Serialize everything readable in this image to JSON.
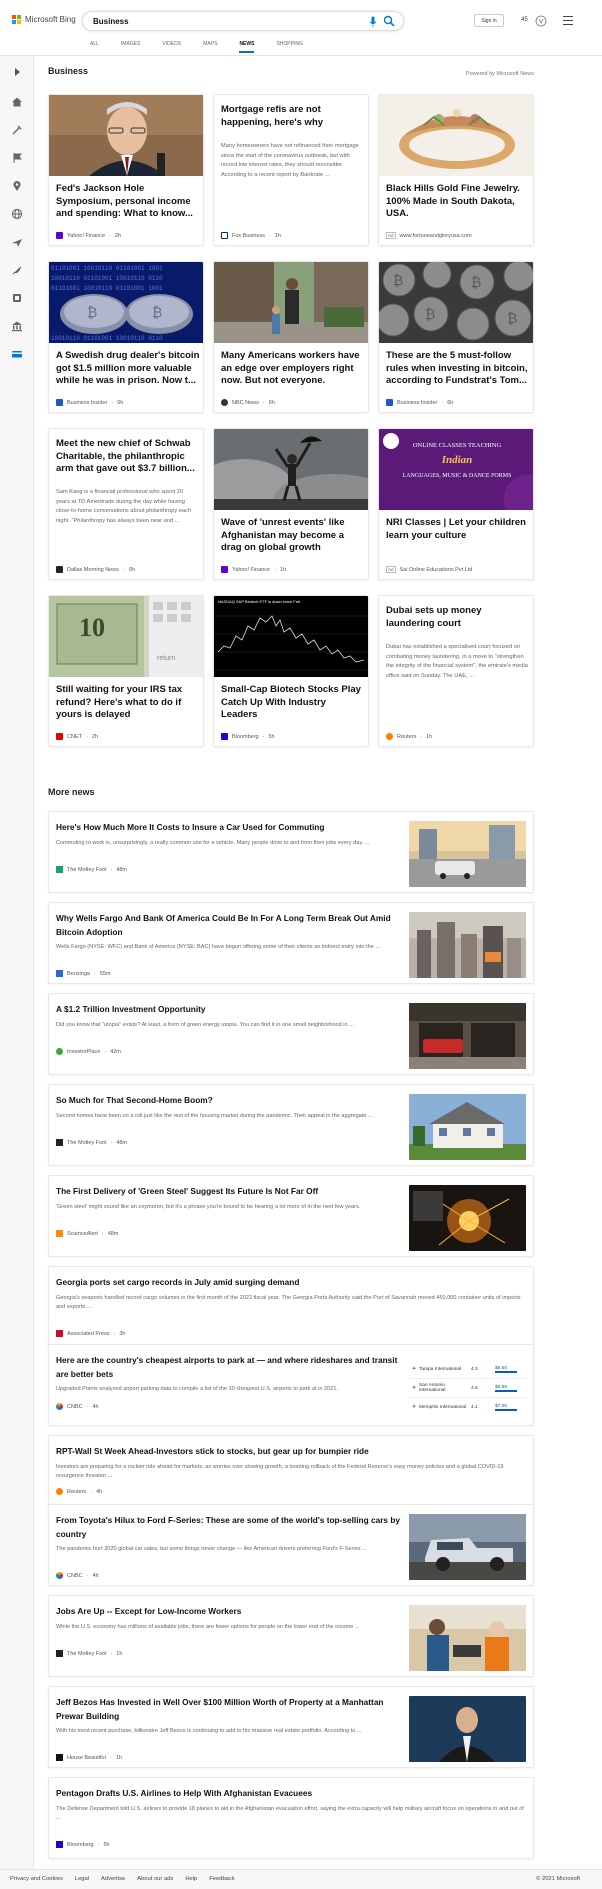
{
  "header": {
    "brand": "Microsoft Bing",
    "query": "Business",
    "sign_in": "Sign in",
    "points": "45",
    "tabs": [
      "ALL",
      "IMAGES",
      "VIDEOS",
      "MAPS",
      "NEWS",
      "SHOPPING"
    ],
    "active_tab": "NEWS"
  },
  "colors": {
    "accent": "#0f6cbd",
    "bing_blue": "#0078d4",
    "logo": [
      "#f25022",
      "#7fba00",
      "#00a4ef",
      "#ffb900"
    ]
  },
  "sidebar": {
    "icons": [
      "expand-icon",
      "home-icon",
      "tools-icon",
      "flag-icon",
      "location-icon",
      "globe-icon",
      "plane-icon",
      "rocket-icon",
      "trophy-icon",
      "building-icon",
      "card-icon"
    ]
  },
  "business": {
    "title": "Business",
    "powered_by": "Powered by Microsoft News",
    "cards": [
      {
        "title": "Fed's Jackson Hole Symposium, personal income and spending: What to know...",
        "desc": "",
        "source": "Yahoo! Finance",
        "age": "2h",
        "icon": "yahoo"
      },
      {
        "title": "Mortgage refis are not happening, here's why",
        "desc": "Many homeowners have not refinanced their mortgage since the start of the coronavirus outbreak, but with record low interest rates, they should reconsider. According to a recent report by Bankrate ...",
        "source": "Fox Business",
        "age": "1h",
        "icon": "fox"
      },
      {
        "title": "Black Hills Gold Fine Jewelry. 100% Made in South Dakota, USA.",
        "desc": "",
        "source": "www.fortuneandgloryusa.com",
        "age": "",
        "ad": "Ad",
        "icon": "ad"
      },
      {
        "title": "A Swedish drug dealer's bitcoin got $1.5 million more valuable while he was in prison. Now t...",
        "desc": "",
        "source": "Business Insider",
        "age": "6h",
        "icon": "bi"
      },
      {
        "title": "Many Americans workers have an edge over employers right now. But not everyone.",
        "desc": "",
        "source": "NBC News",
        "age": "6h",
        "icon": "nbc"
      },
      {
        "title": "These are the 5 must-follow rules when investing in bitcoin, according to Fundstrat's Tom...",
        "desc": "",
        "source": "Business Insider",
        "age": "6h",
        "icon": "bi"
      },
      {
        "title": "Meet the new chief of Schwab Charitable, the philanthropic arm that gave out $3.7 billion...",
        "desc": "Sam Kang is a financial professional who spent 20 years at TD Ameritrade during the day while having close-to-home conversations about philanthropy each night. \"Philanthropy has always been near and ...",
        "source": "Dallas Morning News",
        "age": "6h",
        "icon": "dmn"
      },
      {
        "title": "Wave of 'unrest events' like Afghanistan may become a drag on global growth",
        "desc": "",
        "source": "Yahoo! Finance",
        "age": "1h",
        "icon": "yahoo"
      },
      {
        "title": "NRI Classes | Let your children learn your culture",
        "desc": "",
        "source": "Sai Online Educations Pvt Ltd",
        "age": "",
        "ad": "Ad",
        "icon": "ad"
      },
      {
        "title": "Still waiting for your IRS tax refund? Here's what to do if yours is delayed",
        "desc": "",
        "source": "CNET",
        "age": "2h",
        "icon": "cnet"
      },
      {
        "title": "Small-Cap Biotech Stocks Play Catch Up With Industry Leaders",
        "desc": "",
        "source": "Bloomberg",
        "age": "5h",
        "icon": "bloomberg"
      },
      {
        "title": "Dubai sets up money laundering court",
        "desc": "Dubai has established a specialised court focused on combating money laundering, in a move to \"strengthen the integrity of the financial system\", the emirate's media office said on Sunday. The UAE, ...",
        "source": "Reuters",
        "age": "1h",
        "icon": "reuters"
      }
    ],
    "nri_image_text": [
      "ONLINE CLASSES TEACHING",
      "Indian",
      "LANGUAGES, MUSIC & DANCE FORMS"
    ],
    "chart_image_text": "NASDAQ S&P Biotech ETF is down since Feb.",
    "irs_image_text": [
      "10",
      "return"
    ]
  },
  "more_news": {
    "title": "More news",
    "items": [
      {
        "title": "Here's How Much More It Costs to Insure a Car Used for Commuting",
        "desc": "Commuting to work is, unsurprisingly, a really common use for a vehicle. Many people drive to and from their jobs every day. ...",
        "source": "The Motley Fool",
        "age": "48m",
        "icon": "motley"
      },
      {
        "title": "Why Wells Fargo And Bank Of America Could Be In For A Long Term Break Out Amid Bitcoin Adoption",
        "desc": "Wells Fargo (NYSE: WFC) and Bank of America (NYSE: BAC) have begun offering some of their clients an indirect entry into the ...",
        "source": "Benzinga",
        "age": "55m",
        "icon": "benzinga"
      },
      {
        "title": "A $1.2 Trillion Investment Opportunity",
        "desc": "Did you know that \"utopia\" exists? At least, a form of green energy utopia. You can find it in one small neighborhood in ...",
        "source": "InvestorPlace",
        "age": "42m",
        "icon": "investorplace"
      },
      {
        "title": "So Much for That Second-Home Boom?",
        "desc": "Second homes have been on a roll just like the rest of the housing market during the pandemic. Their appeal in the aggregate ...",
        "source": "The Motley Fool",
        "age": "48m",
        "icon": "motley2"
      },
      {
        "title": "The First Delivery of 'Green Steel' Suggest Its Future Is Not Far Off",
        "desc": "'Green steel' might sound like an oxymoron, but it's a phrase you're bound to be hearing a lot more of in the next few years.",
        "source": "ScienceAlert",
        "age": "48m",
        "icon": "sciencealert"
      },
      {
        "title": "Georgia ports set cargo records in July amid surging demand",
        "desc": "Georgia's seaports handled record cargo volumes in the first month of the 2022 fiscal year. The Georgia Ports Authority said the Port of Savannah moved 450,000 container units of imports and exports ...",
        "source": "Associated Press",
        "age": "3h",
        "icon": "ap"
      },
      {
        "title": "Here are the country's cheapest airports to park at — and where rideshares and transit are better bets",
        "desc": "Upgraded Points analyzed airport parking data to compile a list of the 10 cheapest U.S. airports to park at in 2021.",
        "source": "CNBC",
        "age": "4h",
        "icon": "cnbc"
      },
      {
        "title": "RPT-Wall St Week Ahead-Investors stick to stocks, but gear up for bumpier ride",
        "desc": "Investors are preparing for a rockier ride ahead for markets, as worries over slowing growth, a looming rollback of the Federal Reserve's easy money policies and a global COVID-19 resurgence threaten ...",
        "source": "Reuters",
        "age": "4h",
        "icon": "reuters"
      },
      {
        "title": "From Toyota's Hilux to Ford F-Series: These are some of the world's top-selling cars by country",
        "desc": "The pandemic hurt 2020 global car sales, but some things never change — like American drivers preferring Ford's F-Series ...",
        "source": "CNBC",
        "age": "4h",
        "icon": "cnbc"
      },
      {
        "title": "Jobs Are Up -- Except for Low-Income Workers",
        "desc": "While the U.S. economy has millions of available jobs, there are fewer options for people on the lower end of the income ...",
        "source": "The Motley Fool",
        "age": "1h",
        "icon": "motley2"
      },
      {
        "title": "Jeff Bezos Has Invested in Well Over $100 Million Worth of Property at a Manhattan Prewar Building",
        "desc": "With his most recent purchase, billionaire Jeff Bezos is continuing to add to his massive real estate portfolio. According to ...",
        "source": "House Beautiful",
        "age": "1h",
        "icon": "housebeautiful"
      },
      {
        "title": "Pentagon Drafts U.S. Airlines to Help With Afghanistan Evacuees",
        "desc": "The Defense Department told U.S. airlines to provide 18 planes to aid in the Afghanistan evacuation effort, saying the extra capacity will help military aircraft focus on operations in and out of ...",
        "source": "Bloomberg",
        "age": "5h",
        "icon": "bloomberg"
      }
    ],
    "airport_table": [
      {
        "name": "Tampa International",
        "rating": "4.3",
        "price": "$6.50"
      },
      {
        "name": "San Antonio International",
        "rating": "4.6",
        "price": "$6.95"
      },
      {
        "name": "Memphis International",
        "rating": "4.1",
        "price": "$7.00"
      }
    ]
  },
  "footer": {
    "links": [
      "Privacy and Cookies",
      "Legal",
      "Advertise",
      "About our ads",
      "Help",
      "Feedback"
    ],
    "copyright": "© 2021 Microsoft"
  }
}
